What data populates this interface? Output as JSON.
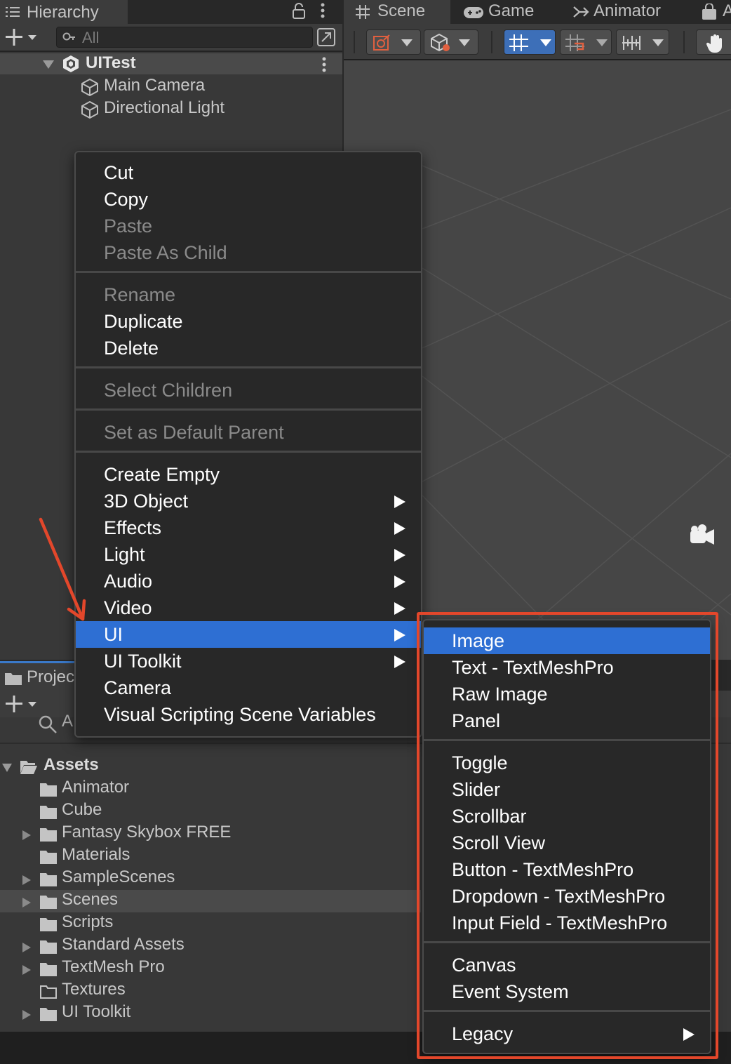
{
  "hierarchy": {
    "tab_label": "Hierarchy",
    "search_placeholder": "All",
    "scene_name": "UITest",
    "children": [
      {
        "label": "Main Camera",
        "icon": "gameobject-cube-icon"
      },
      {
        "label": "Directional Light",
        "icon": "gameobject-cube-icon"
      }
    ]
  },
  "scene_tabs": [
    {
      "label": "Scene",
      "icon": "grid-hash-icon"
    },
    {
      "label": "Game",
      "icon": "gamepad-icon"
    },
    {
      "label": "Animator",
      "icon": "animator-icon"
    },
    {
      "label": "A",
      "icon": "asset-store-bag-icon"
    }
  ],
  "project": {
    "tab_label": "Projec",
    "search_text": "A",
    "root": "Assets",
    "folders": [
      {
        "label": "Animator",
        "foldable": false,
        "selected": false
      },
      {
        "label": "Cube",
        "foldable": false,
        "selected": false
      },
      {
        "label": "Fantasy Skybox FREE",
        "foldable": true,
        "selected": false
      },
      {
        "label": "Materials",
        "foldable": false,
        "selected": false
      },
      {
        "label": "SampleScenes",
        "foldable": true,
        "selected": false
      },
      {
        "label": "Scenes",
        "foldable": true,
        "selected": true
      },
      {
        "label": "Scripts",
        "foldable": false,
        "selected": false
      },
      {
        "label": "Standard Assets",
        "foldable": true,
        "selected": false
      },
      {
        "label": "TextMesh Pro",
        "foldable": true,
        "selected": false
      },
      {
        "label": "Textures",
        "foldable": false,
        "selected": false,
        "outline": true
      },
      {
        "label": "UI Toolkit",
        "foldable": true,
        "selected": false
      }
    ]
  },
  "context_menu": {
    "groups": [
      [
        {
          "label": "Cut",
          "enabled": true
        },
        {
          "label": "Copy",
          "enabled": true
        },
        {
          "label": "Paste",
          "enabled": false
        },
        {
          "label": "Paste As Child",
          "enabled": false
        }
      ],
      [
        {
          "label": "Rename",
          "enabled": false
        },
        {
          "label": "Duplicate",
          "enabled": true
        },
        {
          "label": "Delete",
          "enabled": true
        }
      ],
      [
        {
          "label": "Select Children",
          "enabled": false
        }
      ],
      [
        {
          "label": "Set as Default Parent",
          "enabled": false
        }
      ],
      [
        {
          "label": "Create Empty",
          "enabled": true
        },
        {
          "label": "3D Object",
          "enabled": true,
          "submenu": true
        },
        {
          "label": "Effects",
          "enabled": true,
          "submenu": true
        },
        {
          "label": "Light",
          "enabled": true,
          "submenu": true
        },
        {
          "label": "Audio",
          "enabled": true,
          "submenu": true
        },
        {
          "label": "Video",
          "enabled": true,
          "submenu": true
        },
        {
          "label": "UI",
          "enabled": true,
          "submenu": true,
          "highlighted": true
        },
        {
          "label": "UI Toolkit",
          "enabled": true,
          "submenu": true
        },
        {
          "label": "Camera",
          "enabled": true
        },
        {
          "label": "Visual Scripting Scene Variables",
          "enabled": true
        }
      ]
    ]
  },
  "ui_submenu": {
    "groups": [
      [
        {
          "label": "Image",
          "highlighted": true
        },
        {
          "label": "Text - TextMeshPro"
        },
        {
          "label": "Raw Image"
        },
        {
          "label": "Panel"
        }
      ],
      [
        {
          "label": "Toggle"
        },
        {
          "label": "Slider"
        },
        {
          "label": "Scrollbar"
        },
        {
          "label": "Scroll View"
        },
        {
          "label": "Button - TextMeshPro"
        },
        {
          "label": "Dropdown - TextMeshPro"
        },
        {
          "label": "Input Field - TextMeshPro"
        }
      ],
      [
        {
          "label": "Canvas"
        },
        {
          "label": "Event System"
        }
      ],
      [
        {
          "label": "Legacy",
          "submenu": true
        }
      ]
    ]
  },
  "colors": {
    "menu_highlight": "#2e6fd3",
    "annotation": "#e3472b"
  }
}
